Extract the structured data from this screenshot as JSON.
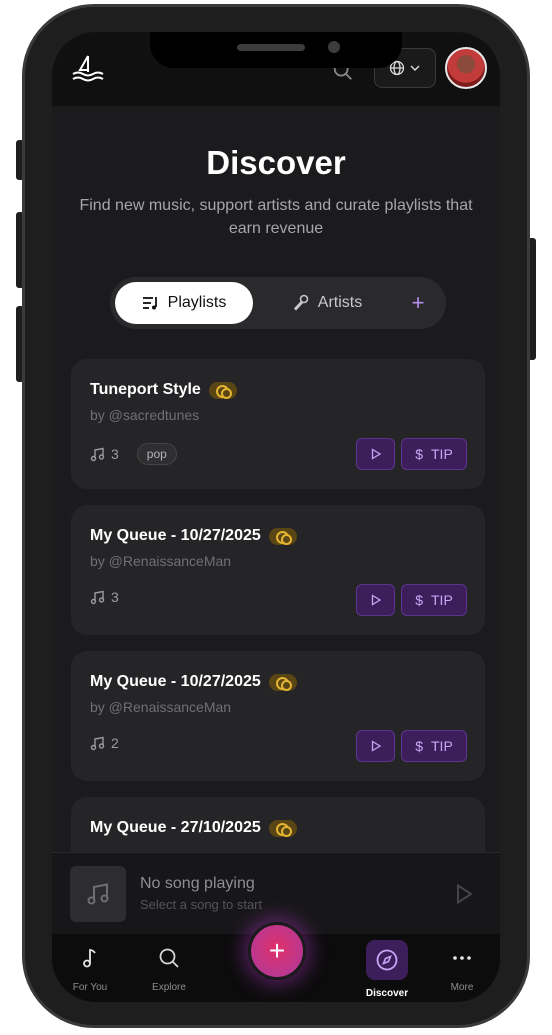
{
  "header": {
    "logo_icon": "ship-on-waves-icon",
    "search_icon": "search-icon",
    "language_icon": "globe-icon",
    "avatar_icon": "user-avatar"
  },
  "hero": {
    "title": "Discover",
    "subtitle": "Find new music, support artists and curate playlists that earn revenue"
  },
  "tabs": {
    "playlists_label": "Playlists",
    "artists_label": "Artists",
    "add_label": "+"
  },
  "playlists": [
    {
      "title": "Tuneport Style",
      "by": "by @sacredtunes",
      "tracks": "3",
      "tag": "pop",
      "tip_label": "TIP"
    },
    {
      "title": "My Queue - 10/27/2025",
      "by": "by @RenaissanceMan",
      "tracks": "3",
      "tip_label": "TIP"
    },
    {
      "title": "My Queue - 10/27/2025",
      "by": "by @RenaissanceMan",
      "tracks": "2",
      "tip_label": "TIP"
    },
    {
      "title": "My Queue - 27/10/2025"
    }
  ],
  "now_playing": {
    "title": "No song playing",
    "subtitle": "Select a song to start"
  },
  "bottom_nav": {
    "for_you": "For You",
    "explore": "Explore",
    "add": "+",
    "discover": "Discover",
    "more": "More"
  },
  "colors": {
    "accent": "#b58ef0",
    "accent_bg": "#3c1f5a",
    "fab": "#e0306a"
  }
}
